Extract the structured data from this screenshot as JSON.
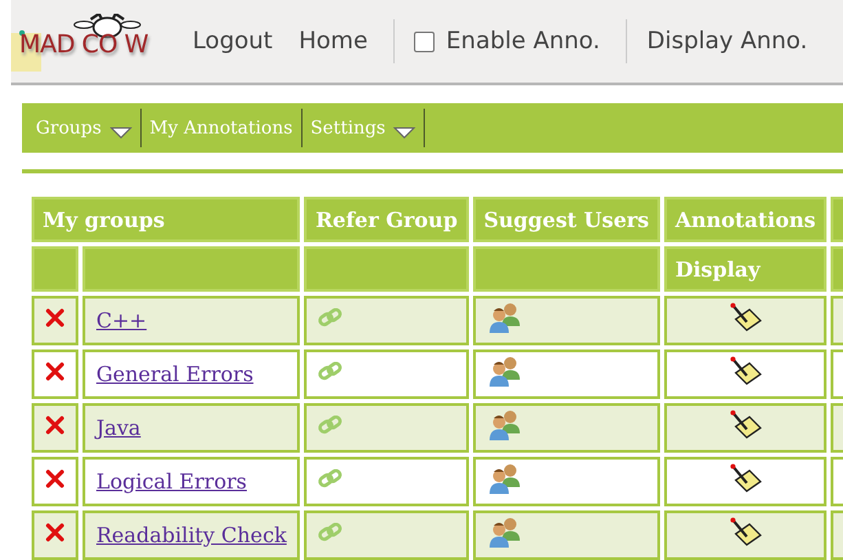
{
  "header": {
    "logo": "MAD CO W",
    "links": [
      {
        "label": "Logout"
      },
      {
        "label": "Home"
      }
    ],
    "enable_annotations": {
      "label": "Enable Anno.",
      "checked": false
    },
    "display_link": "Display Anno."
  },
  "menu": [
    {
      "label": "Groups",
      "dropdown": true
    },
    {
      "label": "My Annotations",
      "dropdown": false
    },
    {
      "label": "Settings",
      "dropdown": true
    }
  ],
  "table": {
    "columns": [
      "My groups",
      "Refer Group",
      "Suggest Users",
      "Annotations"
    ],
    "subheader": "Display",
    "rows": [
      {
        "name": "C++"
      },
      {
        "name": "General Errors"
      },
      {
        "name": "Java"
      },
      {
        "name": "Logical Errors"
      },
      {
        "name": "Readability Check"
      }
    ]
  }
}
